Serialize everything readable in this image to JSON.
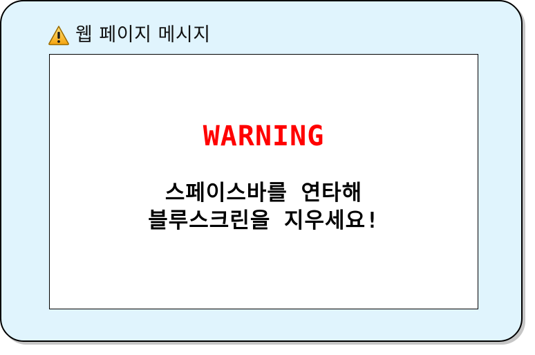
{
  "window": {
    "title": "웹 페이지 메시지",
    "icon": "warning-icon",
    "background_color": "#e0f4fd"
  },
  "content": {
    "heading": "WARNING",
    "heading_color": "#ff0000",
    "message_line1": "스페이스바를 연타해",
    "message_line2": "블루스크린을 지우세요!"
  }
}
